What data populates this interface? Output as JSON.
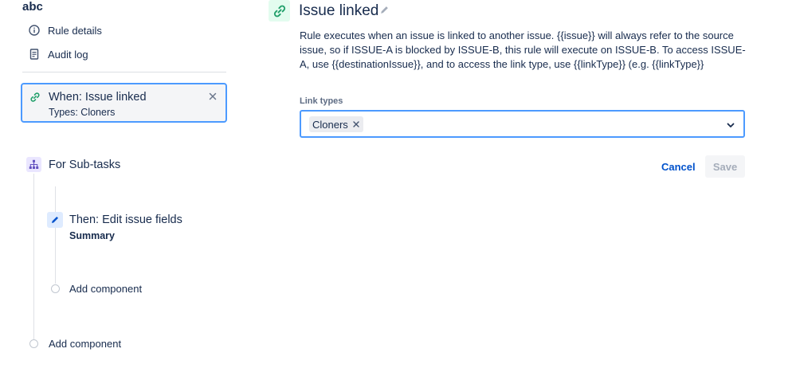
{
  "rule": {
    "name": "abc"
  },
  "sidebar": {
    "menu": [
      {
        "label": "Rule details",
        "icon": "info-icon"
      },
      {
        "label": "Audit log",
        "icon": "document-icon"
      }
    ],
    "trigger": {
      "title": "When: Issue linked",
      "subtitle": "Types: Cloners",
      "icon": "link-icon"
    },
    "branch": {
      "label": "For Sub-tasks",
      "icon": "hierarchy-icon"
    },
    "action": {
      "title": "Then: Edit issue fields",
      "subtitle": "Summary",
      "icon": "pencil-icon"
    },
    "add_component_inner": "Add component",
    "add_component_outer": "Add component"
  },
  "panel": {
    "title": "Issue linked",
    "description": "Rule executes when an issue is linked to another issue. {{issue}} will always refer to the source issue, so if ISSUE-A is blocked by ISSUE-B, this rule will execute on ISSUE-B. To access ISSUE-A, use {{destinationIssue}}, and to access the link type, use {{linkType}} (e.g. {{linkType}}",
    "link_types_label": "Link types",
    "selected_link_types": [
      "Cloners"
    ],
    "cancel_label": "Cancel",
    "save_label": "Save"
  },
  "colors": {
    "accent": "#4c9aff",
    "link": "#0052cc",
    "trigger_icon": "#22a06b",
    "branch_icon": "#6554c0",
    "action_icon": "#0052cc"
  }
}
